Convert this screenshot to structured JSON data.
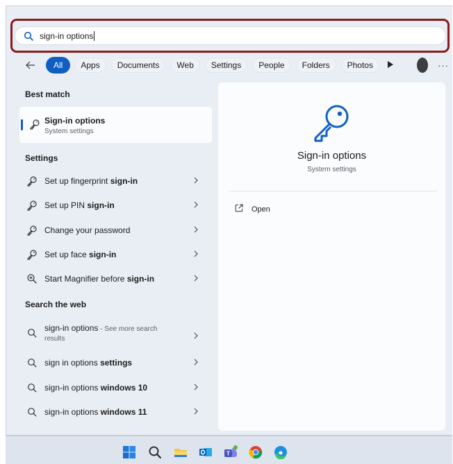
{
  "search": {
    "value": "sign-in options"
  },
  "filters": [
    {
      "label": "All",
      "active": true
    },
    {
      "label": "Apps"
    },
    {
      "label": "Documents"
    },
    {
      "label": "Web"
    },
    {
      "label": "Settings"
    },
    {
      "label": "People"
    },
    {
      "label": "Folders"
    },
    {
      "label": "Photos"
    }
  ],
  "best_match": {
    "heading": "Best match",
    "title": "Sign-in options",
    "subtitle": "System settings"
  },
  "settings_section": {
    "heading": "Settings",
    "items": [
      {
        "pre": "Set up fingerprint ",
        "bold": "sign-in",
        "icon": "key-icon"
      },
      {
        "pre": "Set up PIN ",
        "bold": "sign-in",
        "icon": "key-icon"
      },
      {
        "pre": "Change your password",
        "bold": "",
        "icon": "key-icon"
      },
      {
        "pre": "Set up face ",
        "bold": "sign-in",
        "icon": "key-icon"
      },
      {
        "pre": "Start Magnifier before ",
        "bold": "sign-in",
        "icon": "magnifier-icon"
      }
    ]
  },
  "web_section": {
    "heading": "Search the web",
    "first": {
      "text": "sign-in options",
      "suffix": " - See more search",
      "sub": "results"
    },
    "items": [
      {
        "pre": "sign in options ",
        "bold": "settings"
      },
      {
        "pre": "sign-in options ",
        "bold": "windows 10"
      },
      {
        "pre": "sign-in options ",
        "bold": "windows 11"
      }
    ]
  },
  "detail": {
    "title": "Sign-in options",
    "subtitle": "System settings",
    "open_label": "Open"
  },
  "more_label": "···",
  "colors": {
    "accent": "#0f5fc2",
    "highlight_border": "#8b1a1a",
    "panel_bg": "#e9eef5",
    "taskbar_bg": "#dde4ee"
  },
  "taskbar_icons": [
    "windows-start-icon",
    "search-icon",
    "file-explorer-icon",
    "outlook-icon",
    "teams-icon",
    "chrome-icon",
    "edge-icon"
  ]
}
